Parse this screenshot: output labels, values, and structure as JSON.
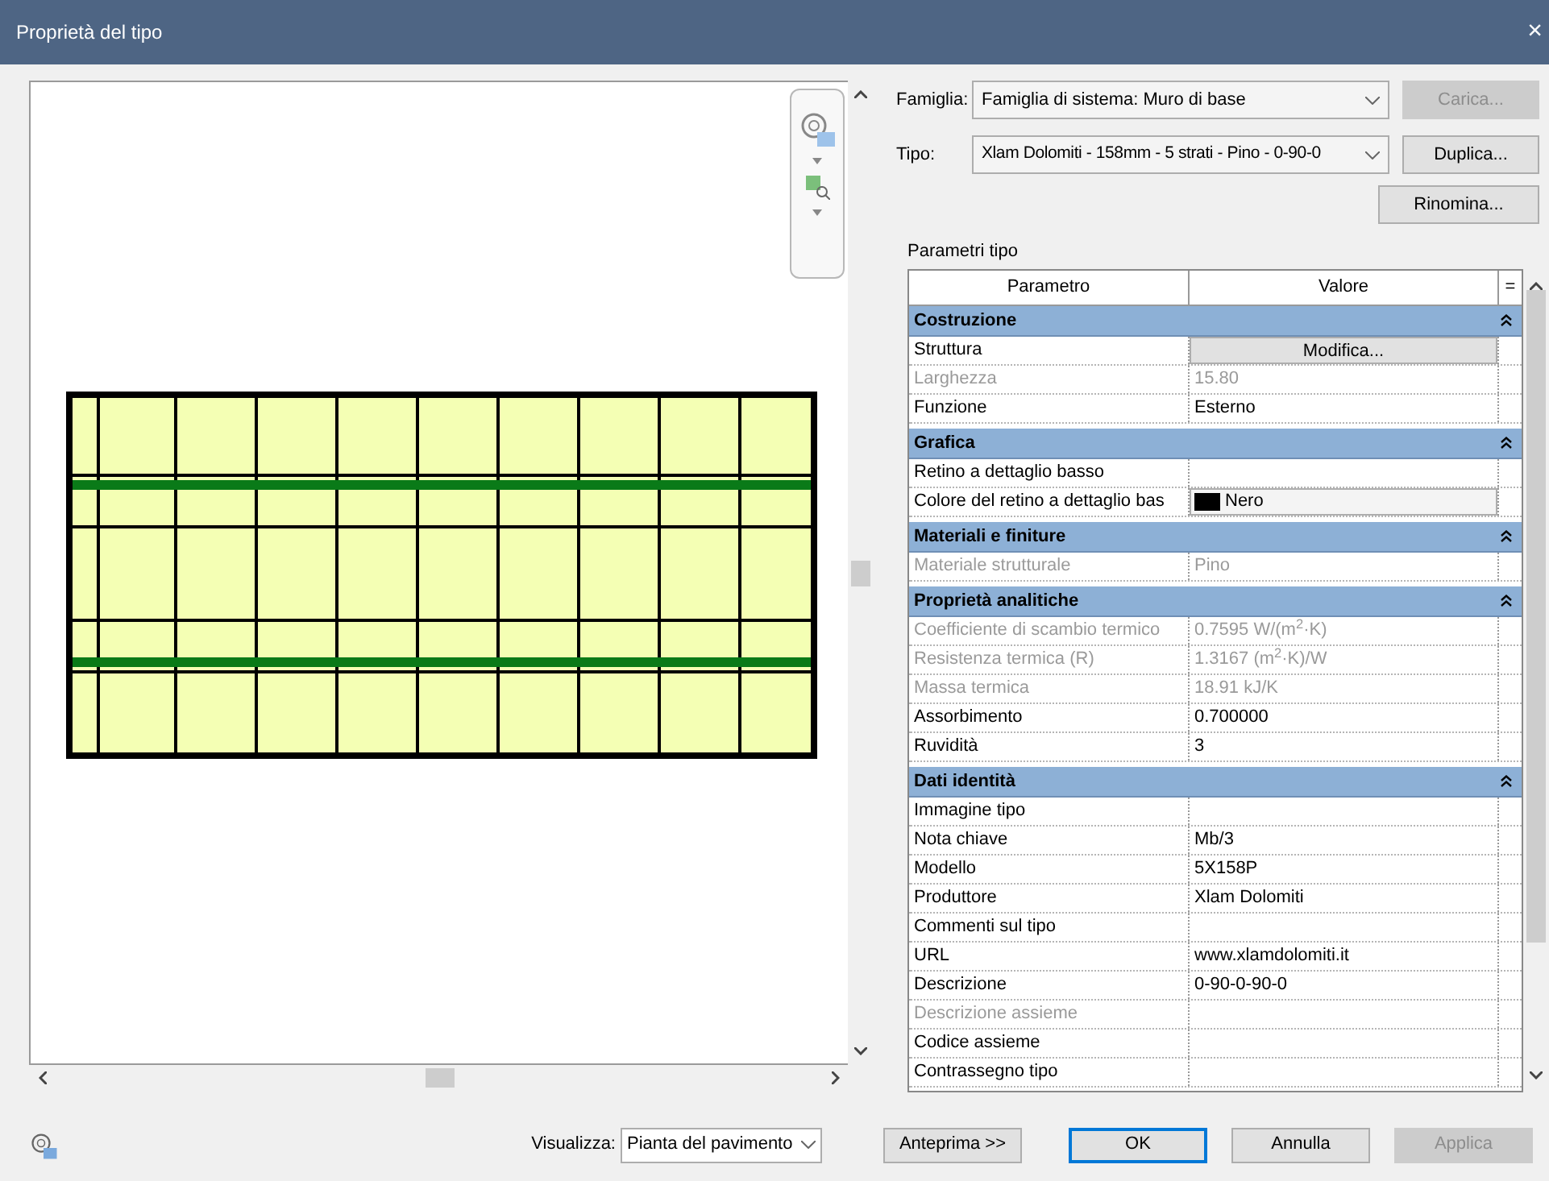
{
  "window": {
    "title": "Proprietà del tipo",
    "close": "×"
  },
  "family": {
    "label": "Famiglia:",
    "value": "Famiglia di sistema: Muro di base"
  },
  "type": {
    "label": "Tipo:",
    "value": "Xlam Dolomiti - 158mm - 5 strati - Pino - 0-90-0"
  },
  "side_buttons": [
    {
      "label": "Carica...",
      "disabled": true
    },
    {
      "label": "Duplica...",
      "disabled": false
    },
    {
      "label": "Rinomina...",
      "disabled": false
    }
  ],
  "params_label": "Parametri tipo",
  "table": {
    "columns": [
      "Parametro",
      "Valore",
      "="
    ],
    "groups": [
      {
        "title": "Costruzione",
        "rows": [
          {
            "name": "Struttura",
            "value": "Modifica...",
            "kind": "button",
            "disabled": false
          },
          {
            "name": "Larghezza",
            "value": "15.80",
            "kind": "text",
            "disabled": true
          },
          {
            "name": "Funzione",
            "value": "Esterno",
            "kind": "text",
            "disabled": false
          }
        ]
      },
      {
        "title": "Grafica",
        "rows": [
          {
            "name": "Retino a dettaglio basso",
            "kind": "text",
            "disabled": false
          },
          {
            "name": "Colore del retino a dettaglio bas",
            "value": "Nero",
            "kind": "color",
            "color": "#000000",
            "disabled": false
          }
        ]
      },
      {
        "title": "Materiali e finiture",
        "rows": [
          {
            "name": "Materiale strutturale",
            "value": "Pino",
            "kind": "text",
            "disabled": true
          }
        ]
      },
      {
        "title": "Proprietà analitiche",
        "rows": [
          {
            "name": "Coefficiente di scambio termico",
            "value": "0.7595 W/(m$^{2}$·K)",
            "kind": "text",
            "disabled": true
          },
          {
            "name": "Resistenza termica (R)",
            "value": "1.3167 (m$^{2}$·K)/W",
            "kind": "text",
            "disabled": true
          },
          {
            "name": "Massa termica",
            "value": "18.91 kJ/K",
            "kind": "text",
            "disabled": true
          },
          {
            "name": "Assorbimento",
            "value": "0.700000",
            "kind": "text",
            "disabled": false
          },
          {
            "name": "Ruvidità",
            "value": "3",
            "kind": "text",
            "disabled": false
          }
        ]
      },
      {
        "title": "Dati identità",
        "rows": [
          {
            "name": "Immagine tipo",
            "kind": "text",
            "disabled": false
          },
          {
            "name": "Nota chiave",
            "value": "Mb/3",
            "kind": "text",
            "disabled": false
          },
          {
            "name": "Modello",
            "value": "5X158P",
            "kind": "text",
            "disabled": false
          },
          {
            "name": "Produttore",
            "value": "Xlam Dolomiti",
            "kind": "text",
            "disabled": false
          },
          {
            "name": "Commenti sul tipo",
            "kind": "text",
            "disabled": false
          },
          {
            "name": "URL",
            "value": "www.xlamdolomiti.it",
            "kind": "text",
            "disabled": false
          },
          {
            "name": "Descrizione",
            "value": "0-90-0-90-0",
            "kind": "text",
            "disabled": false
          },
          {
            "name": "Descrizione assieme",
            "kind": "text",
            "disabled": true
          },
          {
            "name": "Codice assieme",
            "kind": "text",
            "disabled": false
          },
          {
            "name": "Contrassegno tipo",
            "kind": "text",
            "disabled": false
          }
        ]
      }
    ]
  },
  "footer": {
    "view_label": "Visualizza:",
    "view_value": "Pianta del pavimento",
    "buttons": [
      {
        "label": "Anteprima >>",
        "focused": false,
        "disabled": false
      },
      {
        "label": "OK",
        "focused": true,
        "disabled": false
      },
      {
        "label": "Annulla",
        "focused": false,
        "disabled": false
      },
      {
        "label": "Applica",
        "focused": false,
        "disabled": true
      }
    ]
  }
}
